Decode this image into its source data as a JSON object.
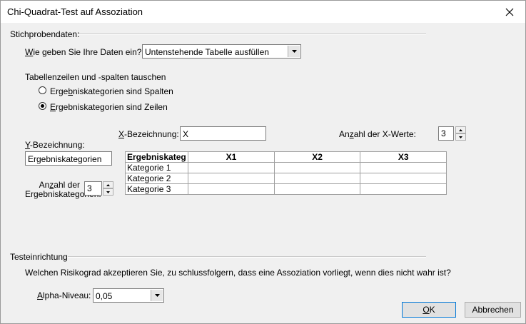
{
  "window": {
    "title": "Chi-Quadrat-Test auf Assoziation"
  },
  "sample": {
    "section_label": "Stichprobendaten:",
    "input_method_label_pre": "",
    "input_method_label_accel": "W",
    "input_method_label_post": "ie geben Sie Ihre Daten ein?",
    "input_method_value": "Untenstehende Tabelle ausfüllen",
    "swap_label": "Tabellenzeilen und -spalten tauschen",
    "radio_columns_pre": "Erge",
    "radio_columns_accel": "b",
    "radio_columns_post": "niskategorien sind Spalten",
    "radio_rows_pre": "",
    "radio_rows_accel": "E",
    "radio_rows_post": "rgebniskategorien sind Zeilen",
    "radio_selected": "rows",
    "x_label_accel": "X",
    "x_label_post": "-Bezeichnung:",
    "x_value": "X",
    "x_count_pre": "An",
    "x_count_accel": "z",
    "x_count_post": "ahl der X-Werte:",
    "x_count_value": "3",
    "y_label_accel": "Y",
    "y_label_post": "-Bezeichnung:",
    "y_value": "Ergebniskategorien",
    "cat_count_line1_pre": "An",
    "cat_count_line1_accel": "z",
    "cat_count_line1_post": "ahl der",
    "cat_count_line2": "Ergebniskategorien:",
    "cat_count_value": "3"
  },
  "table": {
    "corner": "Ergebniskateg",
    "columns": [
      "X1",
      "X2",
      "X3"
    ],
    "rows": [
      "Kategorie 1",
      "Kategorie 2",
      "Kategorie 3"
    ]
  },
  "test": {
    "section_label": "Testeinrichtung",
    "question": "Welchen Risikograd akzeptieren Sie, zu schlussfolgern, dass eine Assoziation vorliegt, wenn dies nicht wahr ist?",
    "alpha_accel": "A",
    "alpha_post": "lpha-Niveau:",
    "alpha_value": "0,05"
  },
  "buttons": {
    "ok_accel": "O",
    "ok_post": "K",
    "cancel": "Abbrechen"
  }
}
